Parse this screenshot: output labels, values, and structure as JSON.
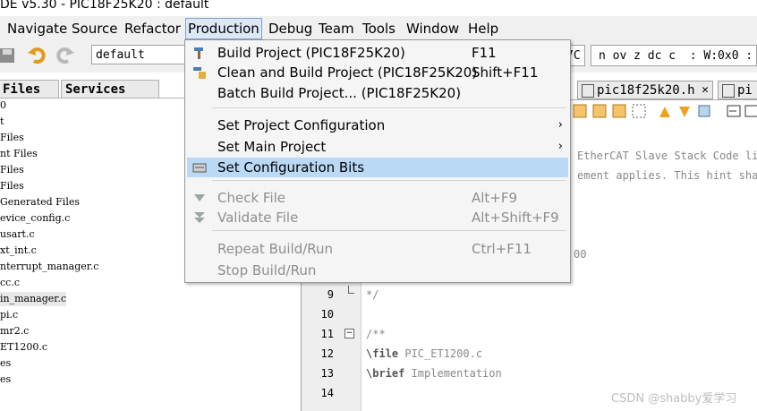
{
  "title": "DE v5.30 - PIC18F25K20 : default",
  "menubar": [
    "Navigate",
    "Source",
    "Refactor",
    "Production",
    "Debug",
    "Team",
    "Tools",
    "Window",
    "Help"
  ],
  "toolbar": {
    "config_value": "default",
    "pc_text": "7C",
    "status_text": "n ov z dc c  : W:0x0 :"
  },
  "left_tabs": [
    "Files",
    "Services"
  ],
  "tree": [
    "0",
    "t",
    "Files",
    "nt Files",
    "Files",
    "Files",
    "Generated Files",
    "evice_config.c",
    "usart.c",
    "xt_int.c",
    "nterrupt_manager.c",
    "cc.c",
    "in_manager.c",
    "pi.c",
    "mr2.c",
    "ET1200.c",
    "es",
    "es"
  ],
  "editor_tabs": [
    "pic18f25k20.h",
    "pi"
  ],
  "code": {
    "frag1": "EtherCAT Slave Stack Code lic",
    "frag2": "ement applies. This hint shall",
    "frag3": "00",
    "lines": [
      {
        "n": "9",
        "t": "*/"
      },
      {
        "n": "10",
        "t": ""
      },
      {
        "n": "11",
        "t": "/**"
      },
      {
        "n": "12",
        "kw": "\\file",
        "t": " PIC_ET1200.c"
      },
      {
        "n": "13",
        "kw": "\\brief",
        "t": " Implementation"
      },
      {
        "n": "14",
        "t": ""
      }
    ]
  },
  "dropdown": {
    "items": [
      {
        "label": "Build Project (PIC18F25K20)",
        "shortcut": "F11",
        "icon": "hammer-icon"
      },
      {
        "label": "Clean and Build Project (PIC18F25K20)",
        "shortcut": "Shift+F11",
        "icon": "broom-icon"
      },
      {
        "label": "Batch Build Project... (PIC18F25K20)",
        "shortcut": ""
      },
      {
        "label": "Set Project Configuration",
        "submenu": true
      },
      {
        "label": "Set Main Project",
        "submenu": true
      },
      {
        "label": "Set Configuration Bits",
        "icon": "config-bits-icon",
        "highlighted": true
      },
      {
        "label": "Check File",
        "shortcut": "Alt+F9",
        "disabled": true,
        "icon": "check-file-icon"
      },
      {
        "label": "Validate File",
        "shortcut": "Alt+Shift+F9",
        "disabled": true,
        "icon": "validate-file-icon"
      },
      {
        "label": "Repeat Build/Run",
        "shortcut": "Ctrl+F11",
        "disabled": true
      },
      {
        "label": "Stop Build/Run",
        "shortcut": "",
        "disabled": true
      }
    ],
    "submenu_arrow": "›"
  },
  "watermark": "CSDN @shabby爱学习",
  "colors": {
    "highlight": "#b9d9f5",
    "menu_active": "#dce8f6",
    "disabled_text": "#8e8e8e"
  }
}
